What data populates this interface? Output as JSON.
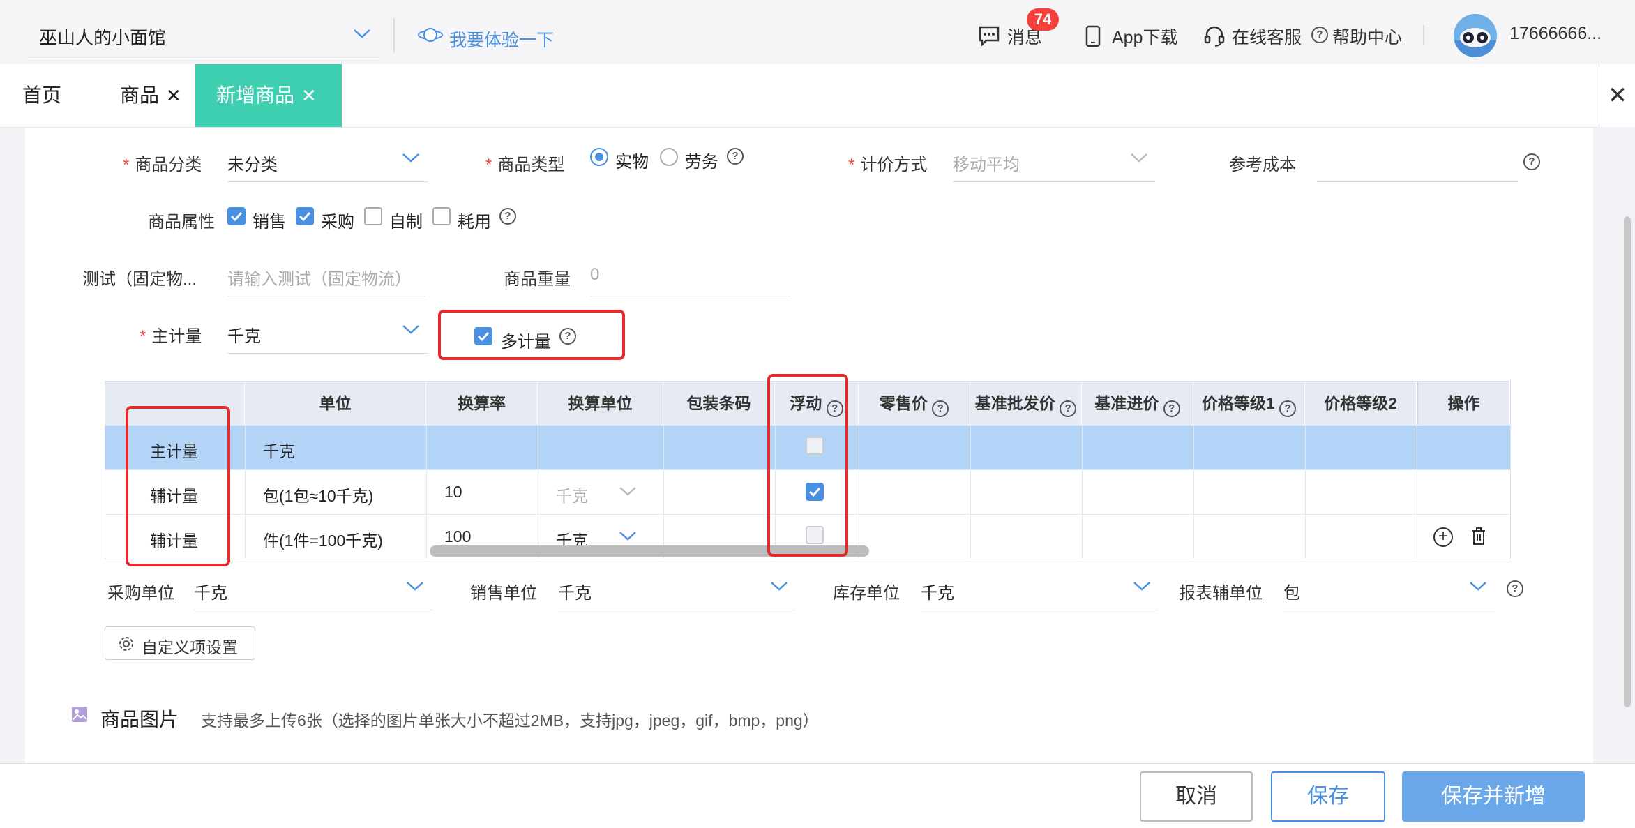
{
  "header": {
    "store_name": "巫山人的小面馆",
    "try_link": "我要体验一下",
    "messages_label": "消息",
    "messages_badge": "74",
    "app_download": "App下载",
    "online_service": "在线客服",
    "help_center": "帮助中心",
    "user_phone": "17666666..."
  },
  "tabs": [
    {
      "label": "首页"
    },
    {
      "label": "商品"
    },
    {
      "label": "新增商品"
    }
  ],
  "form": {
    "category_label": "商品分类",
    "category_value": "未分类",
    "type_label": "商品类型",
    "type_option_physical": "实物",
    "type_option_service": "劳务",
    "pricing_label": "计价方式",
    "pricing_value": "移动平均",
    "ref_cost_label": "参考成本",
    "attr_label": "商品属性",
    "attr_sales": "销售",
    "attr_purchase": "采购",
    "attr_selfmade": "自制",
    "attr_consume": "耗用",
    "test_label": "测试（固定物...",
    "test_placeholder": "请输入测试（固定物流）",
    "weight_label": "商品重量",
    "weight_placeholder": "0",
    "main_unit_label": "主计量",
    "main_unit_value": "千克",
    "multi_unit_label": "多计量"
  },
  "table": {
    "headers": [
      "",
      "单位",
      "换算率",
      "换算单位",
      "包装条码",
      "浮动",
      "零售价",
      "基准批发价",
      "基准进价",
      "价格等级1",
      "价格等级2",
      "操作"
    ],
    "rows": [
      {
        "type": "主计量",
        "unit": "千克",
        "rate": "",
        "conv_unit": "",
        "float": false
      },
      {
        "type": "辅计量",
        "unit": "包(1包≈10千克)",
        "rate": "10",
        "conv_unit": "千克",
        "float": true
      },
      {
        "type": "辅计量",
        "unit": "件(1件=100千克)",
        "rate": "100",
        "conv_unit": "千克",
        "float": false
      }
    ]
  },
  "units": {
    "purchase_label": "采购单位",
    "purchase_value": "千克",
    "sales_label": "销售单位",
    "sales_value": "千克",
    "stock_label": "库存单位",
    "stock_value": "千克",
    "report_label": "报表辅单位",
    "report_value": "包"
  },
  "custom_settings": "自定义项设置",
  "images": {
    "title": "商品图片",
    "hint": "支持最多上传6张（选择的图片单张大小不超过2MB，支持jpg，jpeg，gif，bmp，png）"
  },
  "footer": {
    "cancel": "取消",
    "save": "保存",
    "save_new": "保存并新增"
  },
  "colors": {
    "accent": "#4a90e2",
    "tab_active": "#3ecfb0",
    "required": "#f5413a",
    "highlight_box": "#e52b2b",
    "selected_row": "#b3d4f7"
  }
}
